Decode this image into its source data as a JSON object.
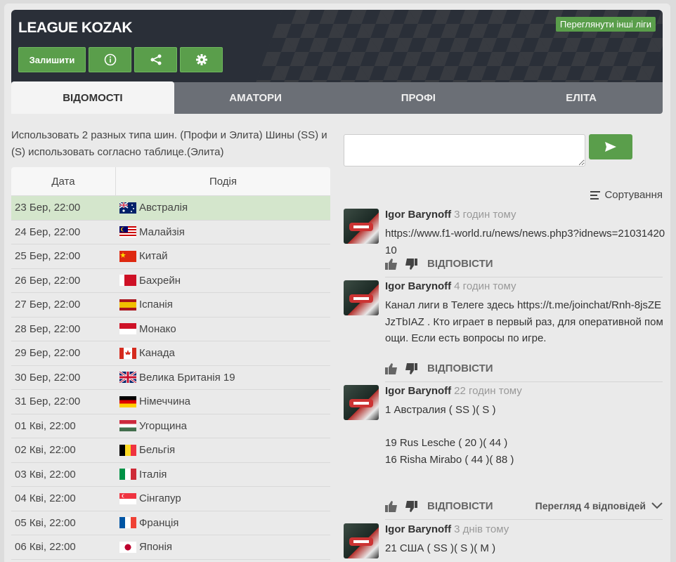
{
  "header": {
    "title": "LEAGUE KOZAK",
    "other_leagues": "Переглянути інші ліги",
    "leave_label": "Залишити"
  },
  "tabs": [
    "ВІДОМОСТІ",
    "АМАТОРИ",
    "ПРОФІ",
    "ЕЛІТА"
  ],
  "description": "Использовать 2 разных типа шин. (Профи и Элита) Шины (SS) и (S) использовать согласно таблице.(Элита)",
  "schedule": {
    "col_date": "Дата",
    "col_event": "Подія",
    "rows": [
      {
        "date": "23 Бер, 22:00",
        "event": "Австралія",
        "flag": "au"
      },
      {
        "date": "24 Бер, 22:00",
        "event": "Малайзія",
        "flag": "my"
      },
      {
        "date": "25 Бер, 22:00",
        "event": "Китай",
        "flag": "cn"
      },
      {
        "date": "26 Бер, 22:00",
        "event": "Бахрейн",
        "flag": "bh"
      },
      {
        "date": "27 Бер, 22:00",
        "event": "Іспанія",
        "flag": "es"
      },
      {
        "date": "28 Бер, 22:00",
        "event": "Монако",
        "flag": "mc"
      },
      {
        "date": "29 Бер, 22:00",
        "event": "Канада",
        "flag": "ca"
      },
      {
        "date": "30 Бер, 22:00",
        "event": "Велика Британія 19",
        "flag": "gb"
      },
      {
        "date": "31 Бер, 22:00",
        "event": "Німеччина",
        "flag": "de"
      },
      {
        "date": "01 Кві, 22:00",
        "event": "Угорщина",
        "flag": "hu"
      },
      {
        "date": "02 Кві, 22:00",
        "event": "Бельгія",
        "flag": "be"
      },
      {
        "date": "03 Кві, 22:00",
        "event": "Італія",
        "flag": "it"
      },
      {
        "date": "04 Кві, 22:00",
        "event": "Сінгапур",
        "flag": "sg"
      },
      {
        "date": "05 Кві, 22:00",
        "event": "Франція",
        "flag": "fr"
      },
      {
        "date": "06 Кві, 22:00",
        "event": "Японія",
        "flag": "jp"
      }
    ]
  },
  "chat": {
    "sort_label": "Сортування",
    "reply_label": "ВІДПОВІСТИ",
    "comments": [
      {
        "name": "Igor Barynoff",
        "time": "3 годин тому",
        "lines": [
          "https://www.f1-world.ru/news/news.php3?idnews=2103142010"
        ]
      },
      {
        "name": "Igor Barynoff",
        "time": "4 годин тому",
        "lines": [
          "Канал лиги в Телеге здесь https://t.me/joinchat/Rnh-8jsZEJzTbIAZ . Кто играет в первый раз, для оперативной помощи. Если есть вопросы по игре."
        ]
      },
      {
        "name": "Igor Barynoff",
        "time": "22 годин тому",
        "lines": [
          "1 Австралия ( SS )( S )",
          "",
          "19 Rus Lesche ( 20 )( 44 )",
          "16 Risha Mirabo ( 44 )( 88 )"
        ],
        "replies": "Перегляд 4 відповідей"
      },
      {
        "name": "Igor Barynoff",
        "time": "3 днів тому",
        "lines": [
          "21 США ( SS )( S )( M )"
        ]
      }
    ]
  }
}
